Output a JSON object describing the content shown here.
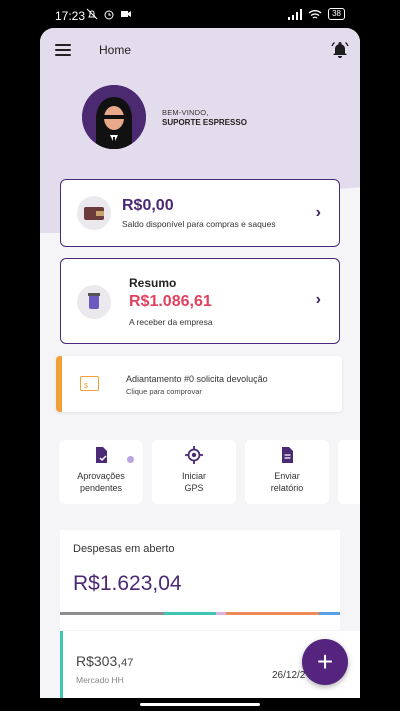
{
  "status": {
    "time": "17:23",
    "battery": "38"
  },
  "header": {
    "title": "Home"
  },
  "user": {
    "greeting": "BEM-VINDO,",
    "name": "SUPORTE ESPRESSO"
  },
  "balance": {
    "amount": "R$0,00",
    "label": "Saldo disponível para compras e saques"
  },
  "summary": {
    "title": "Resumo",
    "amount": "R$1.086,61",
    "label": "A receber da empresa"
  },
  "notice": {
    "title": "Adiantamento #0 solicita devolução",
    "subtitle": "Clique para comprovar"
  },
  "actions": [
    {
      "line1": "Aprovações",
      "line2": "pendentes"
    },
    {
      "line1": "Iniciar",
      "line2": "GPS"
    },
    {
      "line1": "Enviar",
      "line2": "relatório"
    }
  ],
  "expenses": {
    "title": "Despesas em aberto",
    "amount": "R$1.623,04"
  },
  "expense_item": {
    "amount_main": "R$303,",
    "amount_cents": "47",
    "merchant": "Mercado HH",
    "date": "26/12/2"
  },
  "fab": {
    "label": "+"
  },
  "colors": {
    "primary": "#4a2a75",
    "accent_red": "#e0415f",
    "warning": "#f0a037",
    "teal": "#3fc6b2"
  }
}
